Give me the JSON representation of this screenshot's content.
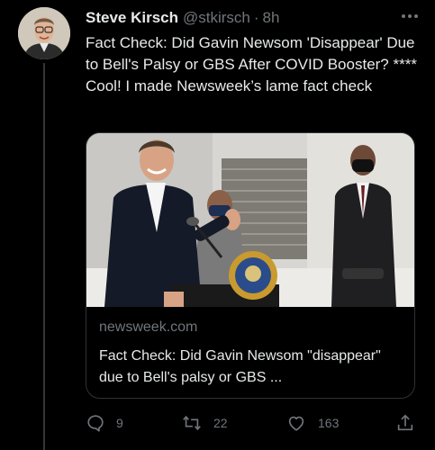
{
  "tweet": {
    "author_name": "Steve Kirsch",
    "author_handle": "@stkirsch",
    "separator": "·",
    "time": "8h",
    "text": "Fact Check: Did Gavin Newsom 'Disappear' Due to Bell's Palsy or GBS After COVID Booster? **** Cool! I made Newsweek’s lame fact check"
  },
  "card": {
    "domain": "newsweek.com",
    "title": "Fact Check: Did Gavin Newsom \"disappear\" due to Bell's palsy or GBS ..."
  },
  "actions": {
    "reply_count": "9",
    "retweet_count": "22",
    "like_count": "163"
  },
  "icons": {
    "more": "more-horizontal-icon",
    "reply": "reply-icon",
    "retweet": "retweet-icon",
    "like": "heart-icon",
    "share": "share-icon"
  },
  "colors": {
    "background": "#000000",
    "text": "#e7e9ea",
    "secondary": "#71767b",
    "border": "#2f3336"
  }
}
